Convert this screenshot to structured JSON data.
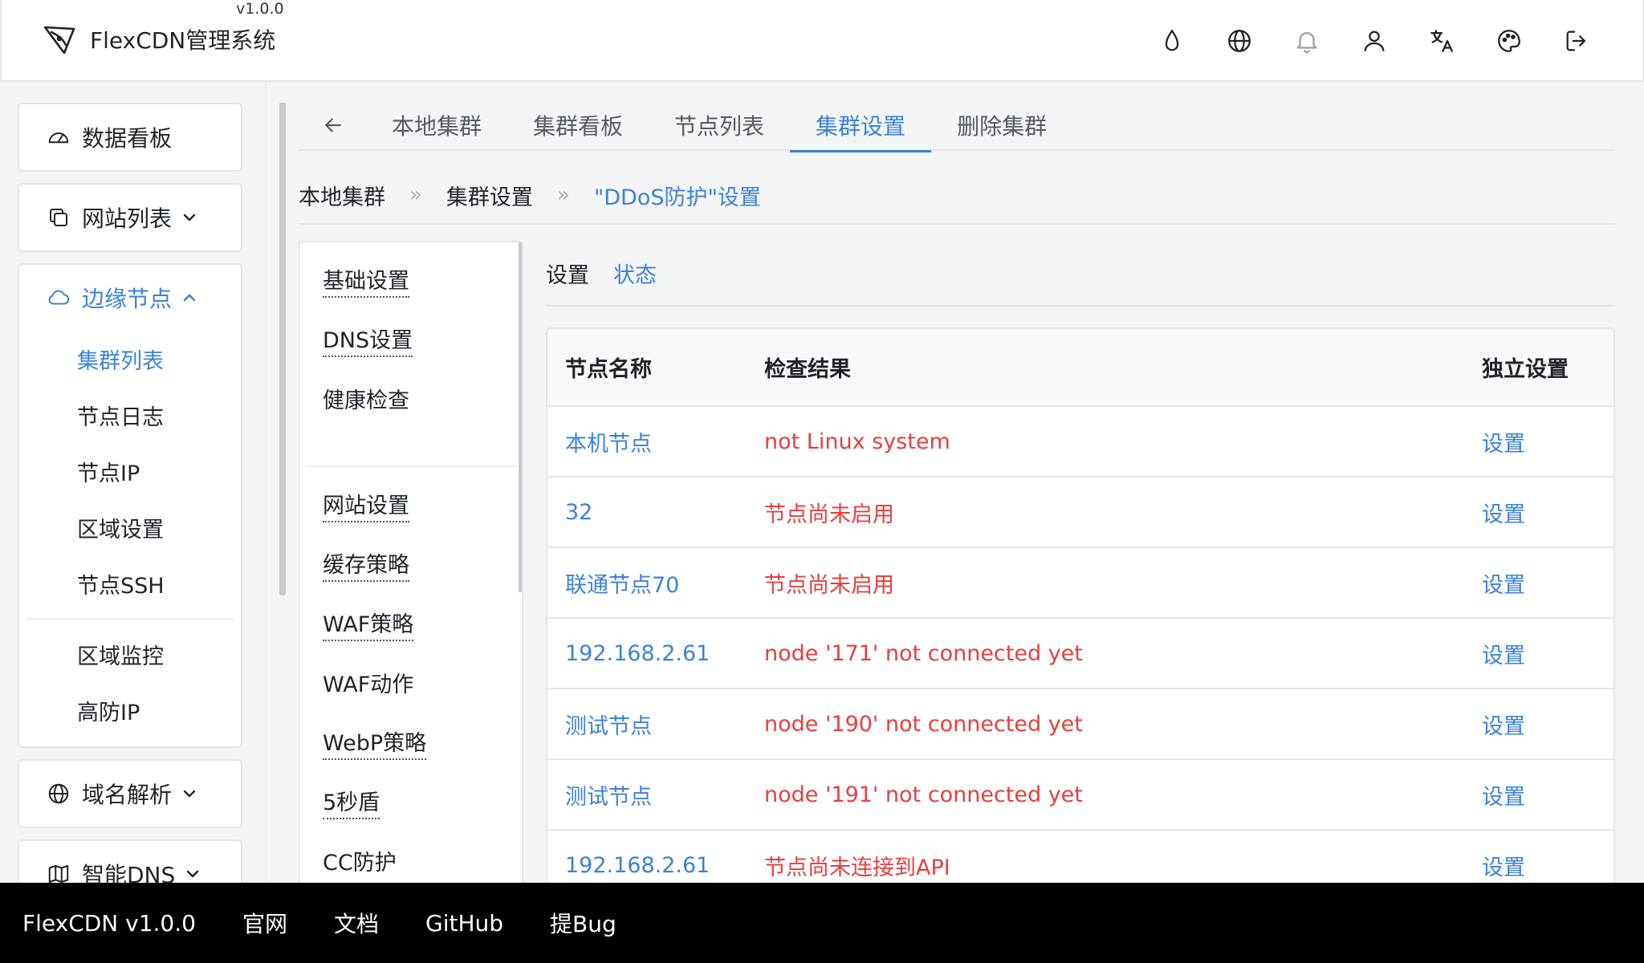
{
  "header": {
    "title": "FlexCDN管理系统",
    "version": "v1.0.0",
    "icons": [
      "drop-icon",
      "globe-icon",
      "bell-icon",
      "user-icon",
      "translate-icon",
      "palette-icon",
      "logout-icon"
    ]
  },
  "sidebar": {
    "dashboard": "数据看板",
    "websites": "网站列表",
    "edge_nodes": "边缘节点",
    "edge_sub": [
      "集群列表",
      "节点日志",
      "节点IP",
      "区域设置",
      "节点SSH"
    ],
    "edge_sub2": [
      "区域监控",
      "高防IP"
    ],
    "dns": "域名解析",
    "smart_dns": "智能DNS"
  },
  "tabs": {
    "items": [
      "本地集群",
      "集群看板",
      "节点列表",
      "集群设置",
      "删除集群"
    ],
    "active": "集群设置"
  },
  "breadcrumb": {
    "items": [
      "本地集群",
      "集群设置"
    ],
    "sep": "»",
    "current": "\"DDoS防护\"设置"
  },
  "inner_menu": {
    "group1": [
      "基础设置",
      "DNS设置",
      "健康检查"
    ],
    "group2": [
      "网站设置",
      "缓存策略",
      "WAF策略",
      "WAF动作",
      "WebP策略",
      "5秒盾",
      "CC防护"
    ]
  },
  "subtabs": {
    "settings": "设置",
    "status": "状态"
  },
  "table": {
    "headers": [
      "节点名称",
      "检查结果",
      "独立设置"
    ],
    "rows": [
      {
        "name": "本机节点",
        "result": "not Linux system",
        "action": "设置"
      },
      {
        "name": "32",
        "result": "节点尚未启用",
        "action": "设置"
      },
      {
        "name": "联通节点70",
        "result": "节点尚未启用",
        "action": "设置"
      },
      {
        "name": "192.168.2.61",
        "result": "node '171' not connected yet",
        "action": "设置"
      },
      {
        "name": "测试节点",
        "result": "node '190' not connected yet",
        "action": "设置"
      },
      {
        "name": "测试节点",
        "result": "node '191' not connected yet",
        "action": "设置"
      },
      {
        "name": "192.168.2.61",
        "result": "节点尚未连接到API",
        "action": "设置"
      }
    ]
  },
  "footer": {
    "version": "FlexCDN v1.0.0",
    "site": "官网",
    "docs": "文档",
    "github": "GitHub",
    "bug": "提Bug"
  },
  "colors": {
    "accent": "#3b82d8",
    "error": "#e5403f",
    "border": "#e3e6ea"
  }
}
